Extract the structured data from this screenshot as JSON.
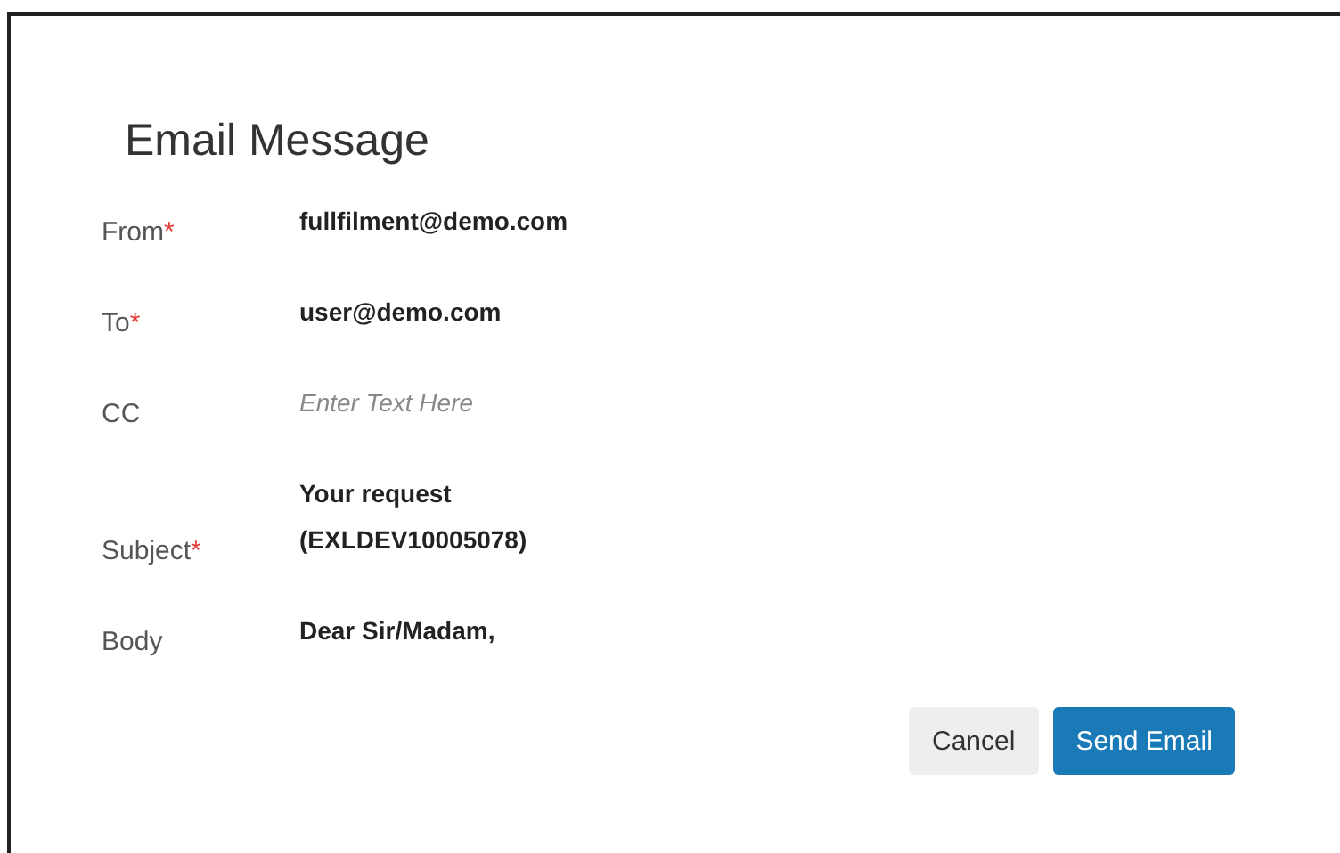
{
  "dialog": {
    "title": "Email Message",
    "fields": [
      {
        "label": "From",
        "required_mark": "*",
        "value": "fullfilment@demo.com"
      },
      {
        "label": "To",
        "required_mark": "*",
        "value": "user@demo.com"
      },
      {
        "label": "CC",
        "placeholder": "Enter Text Here"
      },
      {
        "label": "Subject",
        "required_mark": "*",
        "value": "Your request (EXLDEV10005078)"
      },
      {
        "label": "Body",
        "value": "Dear Sir/Madam,"
      }
    ],
    "buttons": [
      {
        "label": "Cancel",
        "primary": false
      },
      {
        "label": "Send Email",
        "primary": true
      }
    ]
  }
}
